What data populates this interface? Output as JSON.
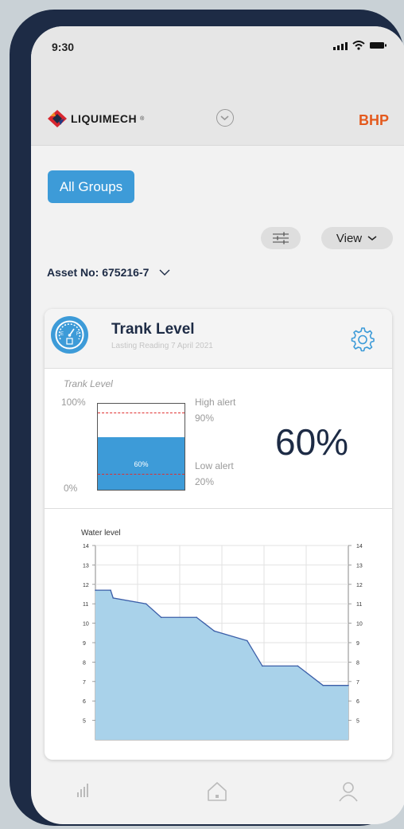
{
  "status_bar": {
    "time": "9:30"
  },
  "header": {
    "logo_text": "LIQUIMECH",
    "trademark": "®",
    "brand": "BHP"
  },
  "toolbar": {
    "groups_label": "All Groups",
    "view_label": "View"
  },
  "asset": {
    "label": "Asset No: 675216-7"
  },
  "card": {
    "title": "Trank Level",
    "subtitle": "Lasting Reading 7 April 2021",
    "tank": {
      "caption": "Trank Level",
      "top_label": "100%",
      "bottom_label": "0%",
      "fill_percent": 60,
      "fill_label": "60%",
      "high_alert_label": "High alert",
      "high_alert_value": "90%",
      "high_alert_percent": 90,
      "low_alert_label": "Low alert",
      "low_alert_value": "20%",
      "low_alert_percent": 20,
      "big_value": "60%"
    }
  },
  "chart_data": {
    "type": "area",
    "title": "Water level",
    "xlabel": "",
    "ylabel": "",
    "ylim": [
      4,
      14
    ],
    "yticks": [
      5,
      6,
      7,
      8,
      9,
      10,
      11,
      12,
      13,
      14
    ],
    "grid": true,
    "x": [
      0,
      0.06,
      0.07,
      0.2,
      0.26,
      0.4,
      0.47,
      0.6,
      0.66,
      0.8,
      0.9,
      1.0
    ],
    "series": [
      {
        "values": [
          11.7,
          11.7,
          11.3,
          11.0,
          10.3,
          10.3,
          9.6,
          9.1,
          7.8,
          7.8,
          6.8,
          6.8
        ]
      }
    ],
    "fill_color": "#a9d2ea",
    "line_color": "#3b5ea8"
  },
  "bottom_nav": {
    "items": [
      "stats-icon",
      "home-icon",
      "user-icon"
    ]
  },
  "colors": {
    "accent": "#3d9bd8",
    "navy": "#1d2b45",
    "brand_orange": "#e45a1e",
    "alert_red": "#e03030"
  }
}
